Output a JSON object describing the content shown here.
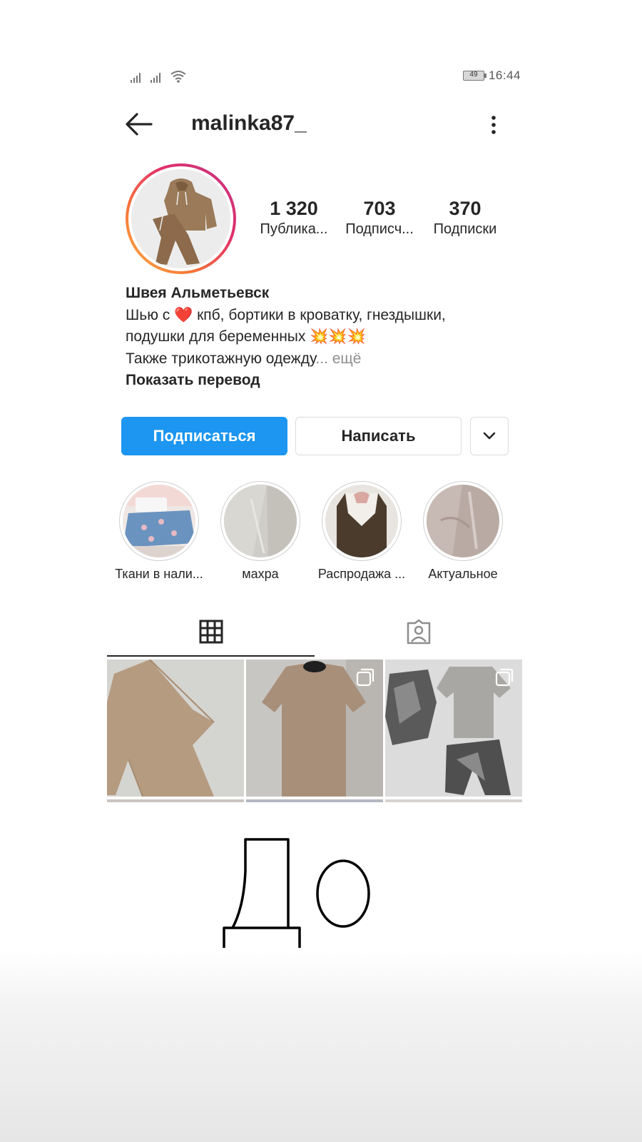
{
  "status_bar": {
    "battery": "49",
    "time": "16:44"
  },
  "header": {
    "username": "malinka87_"
  },
  "stats": [
    {
      "value": "1 320",
      "label": "Публика..."
    },
    {
      "value": "703",
      "label": "Подписч..."
    },
    {
      "value": "370",
      "label": "Подписки"
    }
  ],
  "bio": {
    "name": "Швея Альметьевск",
    "line1_before": "Шью с ",
    "line1_heart": "❤️",
    "line1_after": " кпб, бортики в кроватку, гнездышки,",
    "line2": "подушки для беременных 💥💥💥",
    "line3": "Также трикотажную одежду",
    "ellipsis": "...",
    "more": " ещё",
    "translate": "Показать перевод"
  },
  "buttons": {
    "follow": "Подписаться",
    "message": "Написать"
  },
  "highlights": [
    {
      "label": "Ткани в нали..."
    },
    {
      "label": "махра"
    },
    {
      "label": "Распродажа ..."
    },
    {
      "label": "Актуальное"
    }
  ],
  "handwritten_text": "До",
  "colors": {
    "follow_button": "#1c96f0",
    "heart": "#e0242f",
    "secondary_text": "#8e8e8e"
  }
}
